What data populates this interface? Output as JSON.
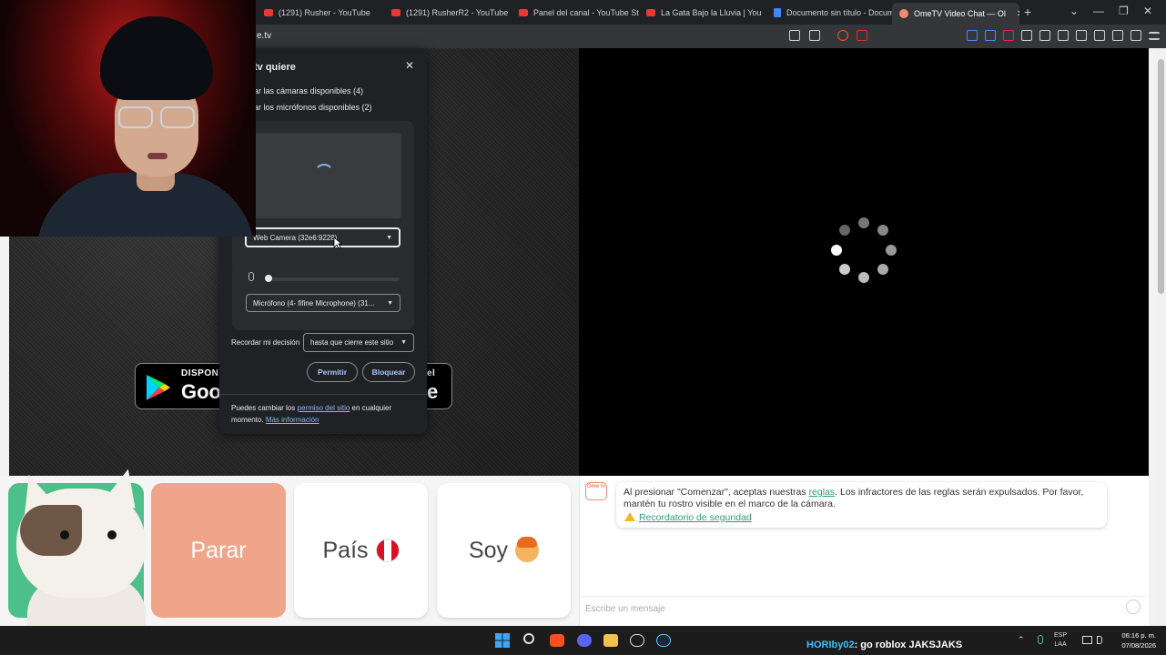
{
  "tabs": [
    {
      "label": "(1291) Rusher - YouTube",
      "icon": "youtube-icon"
    },
    {
      "label": "(1291) RusherR2 - YouTube",
      "icon": "youtube-icon"
    },
    {
      "label": "Panel del canal - YouTube Stu",
      "icon": "youtube-icon"
    },
    {
      "label": "La Gata Bajo la Lluvia | You",
      "icon": "youtube-icon"
    },
    {
      "label": "Documento sin título - Docum",
      "icon": "docs-icon"
    },
    {
      "label": "OmeTV Video Chat — Ol",
      "icon": "ometv-icon"
    }
  ],
  "address": {
    "url": "e.tv"
  },
  "permission": {
    "title": "tv quiere",
    "line_cameras": "ar las cámaras disponibles (4)",
    "line_mics": "ar los micrófonos disponibles (2)",
    "camera_select": "Web Camera (32e6:9228)",
    "mic_select": "Micrófono (4- fifine Microphone) (31...",
    "remember_label": "Recordar mi decisión",
    "remember_select": "hasta que cierre este sitio",
    "allow": "Permitir",
    "block": "Bloquear",
    "foot_prefix": "Puedes cambiar los",
    "foot_link": "permiso del sitio",
    "foot_suffix": "en cualquier",
    "foot_line2": "momento.",
    "foot_more": "Más información"
  },
  "badges": {
    "google_small": "DISPON",
    "google_big": "Goo",
    "apple_small": "el",
    "apple_big": "e"
  },
  "controls": {
    "stop": "Parar",
    "country": "País",
    "gender": "Soy"
  },
  "chat": {
    "logo": "Ome tv",
    "notice_1": "Al presionar \"Comenzar\", aceptas nuestras",
    "notice_link": "reglas",
    "notice_2": ". Los infractores de las reglas serán expulsados. Por favor, mantén tu rostro visible en el marco de la cámara.",
    "reminder": "Recordatorio de seguridad",
    "placeholder": "Escribe un mensaje"
  },
  "taskbar": {
    "stream_user": "HORIby02",
    "stream_text": ": go roblox JAKSJAKS",
    "lang_1": "ESP",
    "lang_2": "LAA",
    "time": "06:16 p. m.",
    "date": "07/08/2026"
  },
  "colors": {
    "accent_green": "#4cbf8b",
    "stop_salmon": "#f0a58a",
    "link_teal": "#2f9a7a"
  }
}
